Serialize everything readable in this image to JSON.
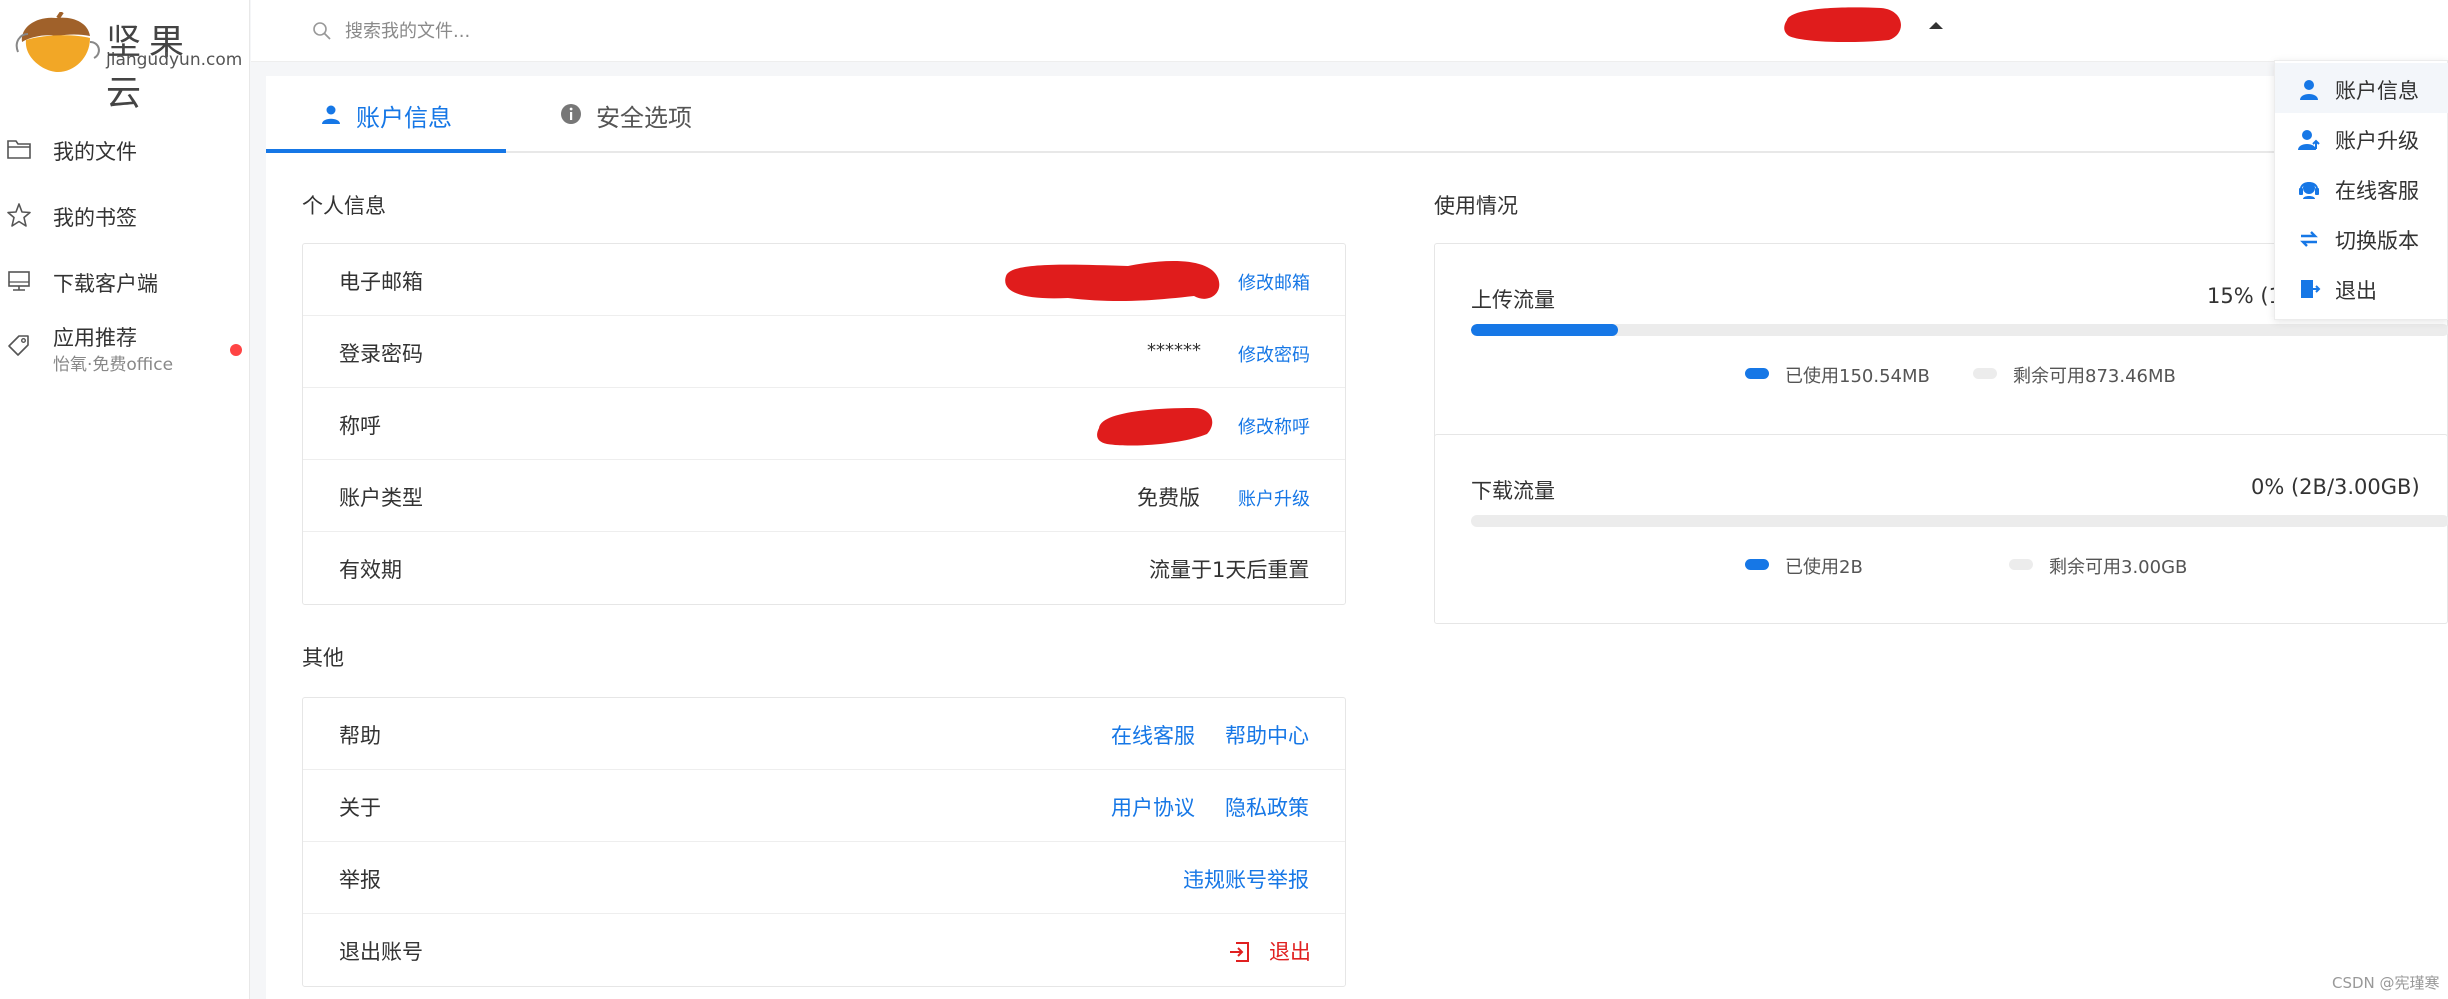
{
  "app": {
    "brand": "坚果云",
    "domain": "jiangudyun.com"
  },
  "sidebar": {
    "items": [
      {
        "label": "我的文件",
        "icon": "folder-icon"
      },
      {
        "label": "我的书签",
        "icon": "star-icon"
      },
      {
        "label": "下载客户端",
        "icon": "monitor-icon"
      },
      {
        "label": "应用推荐",
        "sub": "怡氧·免费office",
        "icon": "tag-icon",
        "badge_color": "#ff4d4f"
      }
    ]
  },
  "search": {
    "placeholder": "搜索我的文件..."
  },
  "tabs": [
    {
      "label": "账户信息",
      "icon": "user-icon",
      "active": true
    },
    {
      "label": "安全选项",
      "icon": "info-icon",
      "active": false
    }
  ],
  "personal": {
    "title": "个人信息",
    "rows": [
      {
        "label": "电子邮箱",
        "value": "",
        "action": "修改邮箱"
      },
      {
        "label": "登录密码",
        "value": "******",
        "action": "修改密码"
      },
      {
        "label": "称呼",
        "value": "",
        "action": "修改称呼"
      },
      {
        "label": "账户类型",
        "value": "免费版",
        "action": "账户升级"
      },
      {
        "label": "有效期",
        "value": "流量于1天后重置",
        "action": ""
      }
    ]
  },
  "other": {
    "title": "其他",
    "rows": [
      {
        "label": "帮助",
        "links": [
          "在线客服",
          "帮助中心"
        ]
      },
      {
        "label": "关于",
        "links": [
          "用户协议",
          "隐私政策"
        ]
      },
      {
        "label": "举报",
        "links": [
          "违规账号举报"
        ]
      },
      {
        "label": "退出账号",
        "links": [
          "退出"
        ]
      }
    ],
    "logout_color": "#e02020"
  },
  "usage": {
    "title": "使用情况",
    "upload": {
      "title": "上传流量",
      "percent_text": "15% (1",
      "fill": 0.15,
      "used": "已使用150.54MB",
      "remaining": "剩余可用873.46MB"
    },
    "download": {
      "title": "下载流量",
      "percent_text": "0% (2B/3.00GB)",
      "fill": 0.0,
      "used": "已使用2B",
      "remaining": "剩余可用3.00GB"
    }
  },
  "dropdown": {
    "items": [
      {
        "label": "账户信息",
        "icon": "user-icon"
      },
      {
        "label": "账户升级",
        "icon": "user-upgrade-icon"
      },
      {
        "label": "在线客服",
        "icon": "headset-icon"
      },
      {
        "label": "切换版本",
        "icon": "switch-icon"
      },
      {
        "label": "退出",
        "icon": "exit-icon"
      }
    ]
  },
  "colors": {
    "accent": "#1677e6",
    "redaction": "#e01c1c"
  },
  "watermark": "CSDN @宪瑾寒"
}
